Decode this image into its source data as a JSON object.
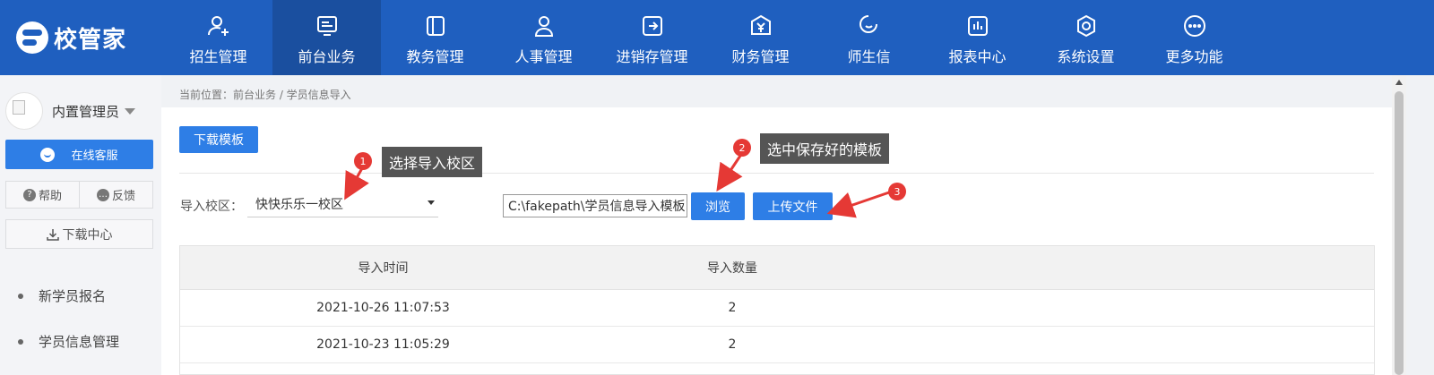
{
  "app": {
    "logo_text": "校管家"
  },
  "nav": {
    "items": [
      {
        "label": "招生管理",
        "icon": "user-add-icon"
      },
      {
        "label": "前台业务",
        "icon": "monitor-icon",
        "active": true
      },
      {
        "label": "教务管理",
        "icon": "book-icon"
      },
      {
        "label": "人事管理",
        "icon": "person-icon"
      },
      {
        "label": "进销存管理",
        "icon": "inventory-icon"
      },
      {
        "label": "财务管理",
        "icon": "money-icon"
      },
      {
        "label": "师生信",
        "icon": "chat-icon"
      },
      {
        "label": "报表中心",
        "icon": "chart-icon"
      },
      {
        "label": "系统设置",
        "icon": "settings-icon"
      },
      {
        "label": "更多功能",
        "icon": "more-icon"
      }
    ]
  },
  "sidebar": {
    "user_name": "内置管理员",
    "online_service": "在线客服",
    "help": "帮助",
    "feedback": "反馈",
    "download_center": "下载中心",
    "items": [
      {
        "label": "新学员报名"
      },
      {
        "label": "学员信息管理"
      }
    ]
  },
  "breadcrumb": "当前位置：前台业务 / 学员信息导入",
  "main": {
    "download_template": "下载模板",
    "campus_label": "导入校区：",
    "campus_value": "快快乐乐一校区",
    "file_path": "C:\\fakepath\\学员信息导入模板",
    "browse": "浏览",
    "upload": "上传文件"
  },
  "annotations": [
    {
      "number": "1",
      "text": "选择导入校区"
    },
    {
      "number": "2",
      "text": "选中保存好的模板"
    },
    {
      "number": "3",
      "text": ""
    }
  ],
  "table": {
    "headers": [
      "导入时间",
      "导入数量"
    ],
    "rows": [
      [
        "2021-10-26 11:07:53",
        "2"
      ],
      [
        "2021-10-23 11:05:29",
        "2"
      ]
    ]
  },
  "colors": {
    "nav_bg": "#1f5fbf",
    "nav_active": "#1a4f9f",
    "primary_button": "#2e7ee6",
    "annotation_red": "#e53935",
    "tooltip_bg": "#555555"
  }
}
